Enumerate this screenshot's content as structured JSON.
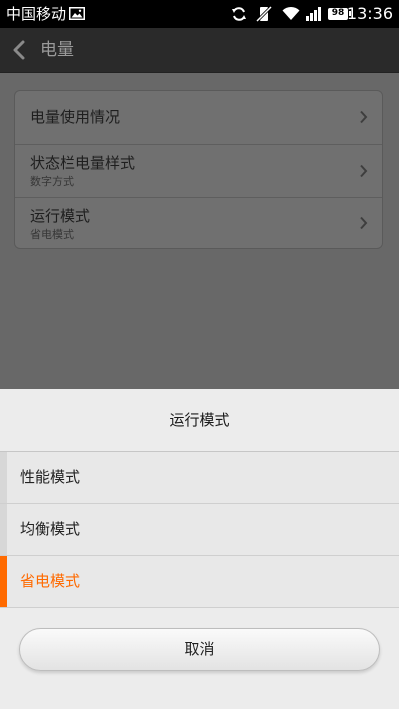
{
  "status_bar": {
    "carrier": "中国移动",
    "battery": "98",
    "time": "13:36"
  },
  "header": {
    "title": "电量"
  },
  "settings": {
    "items": [
      {
        "title": "电量使用情况",
        "subtitle": ""
      },
      {
        "title": "状态栏电量样式",
        "subtitle": "数字方式"
      },
      {
        "title": "运行模式",
        "subtitle": "省电模式"
      }
    ]
  },
  "dialog": {
    "title": "运行模式",
    "options": [
      {
        "label": "性能模式",
        "selected": false
      },
      {
        "label": "均衡模式",
        "selected": false
      },
      {
        "label": "省电模式",
        "selected": true
      }
    ],
    "cancel_label": "取消"
  },
  "colors": {
    "accent": "#ff6a00",
    "scrim": "#686868",
    "sheet_background": "#ececec"
  },
  "icons": {
    "status_left": "image-notification-icon",
    "status_right": [
      "sync-icon",
      "vibrate-off-icon",
      "wifi-icon",
      "signal-icon",
      "battery-icon"
    ],
    "back": "chevron-left-icon",
    "row": "chevron-right-icon"
  }
}
